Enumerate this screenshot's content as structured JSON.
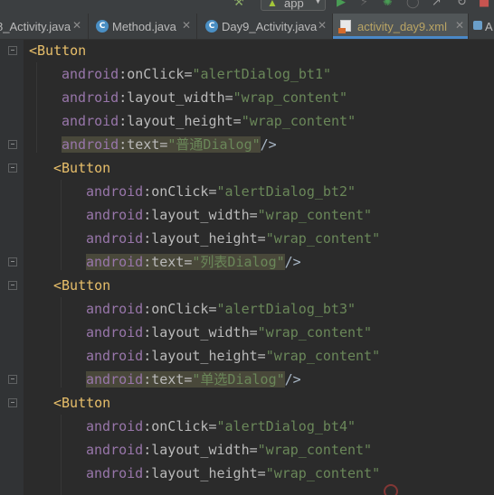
{
  "toolbar": {
    "run_config": "app",
    "icons": [
      "hammer-icon",
      "android-icon",
      "run-icon",
      "debug-icon",
      "bug-icon",
      "profile-icon",
      "attach-icon",
      "stop-icon"
    ]
  },
  "tabs": [
    {
      "label": "8_Activity.java",
      "kind": "java",
      "active": false
    },
    {
      "label": "Method.java",
      "kind": "java",
      "active": false
    },
    {
      "label": "Day9_Activity.java",
      "kind": "java",
      "active": false
    },
    {
      "label": "activity_day9.xml",
      "kind": "xml",
      "active": true
    }
  ],
  "tab_overflow_label": "A",
  "code": {
    "lines": [
      {
        "tag": "<Button"
      },
      {
        "ns": "android",
        "attr": "onClick",
        "value": "\"alertDialog_bt1\""
      },
      {
        "ns": "android",
        "attr": "layout_width",
        "value": "\"wrap_content\""
      },
      {
        "ns": "android",
        "attr": "layout_height",
        "value": "\"wrap_content\""
      },
      {
        "ns": "android",
        "attr": "text",
        "value": "\"普通Dialog\"",
        "close": "/>"
      },
      {
        "tag": "<Button"
      },
      {
        "ns": "android",
        "attr": "onClick",
        "value": "\"alertDialog_bt2\""
      },
      {
        "ns": "android",
        "attr": "layout_width",
        "value": "\"wrap_content\""
      },
      {
        "ns": "android",
        "attr": "layout_height",
        "value": "\"wrap_content\""
      },
      {
        "ns": "android",
        "attr": "text",
        "value": "\"列表Dialog\"",
        "close": "/>"
      },
      {
        "tag": "<Button"
      },
      {
        "ns": "android",
        "attr": "onClick",
        "value": "\"alertDialog_bt3\""
      },
      {
        "ns": "android",
        "attr": "layout_width",
        "value": "\"wrap_content\""
      },
      {
        "ns": "android",
        "attr": "layout_height",
        "value": "\"wrap_content\""
      },
      {
        "ns": "android",
        "attr": "text",
        "value": "\"单选Dialog\"",
        "close": "/>"
      },
      {
        "tag": "<Button"
      },
      {
        "ns": "android",
        "attr": "onClick",
        "value": "\"alertDialog_bt4\""
      },
      {
        "ns": "android",
        "attr": "layout_width",
        "value": "\"wrap_content\""
      },
      {
        "ns": "android",
        "attr": "layout_height",
        "value": "\"wrap_content\""
      }
    ],
    "colors": {
      "background": "#2b2b2b",
      "tag": "#e8bf6a",
      "namespace": "#9876aa",
      "attribute": "#bababa",
      "string": "#6a8759",
      "highlight": "#49483a"
    }
  }
}
